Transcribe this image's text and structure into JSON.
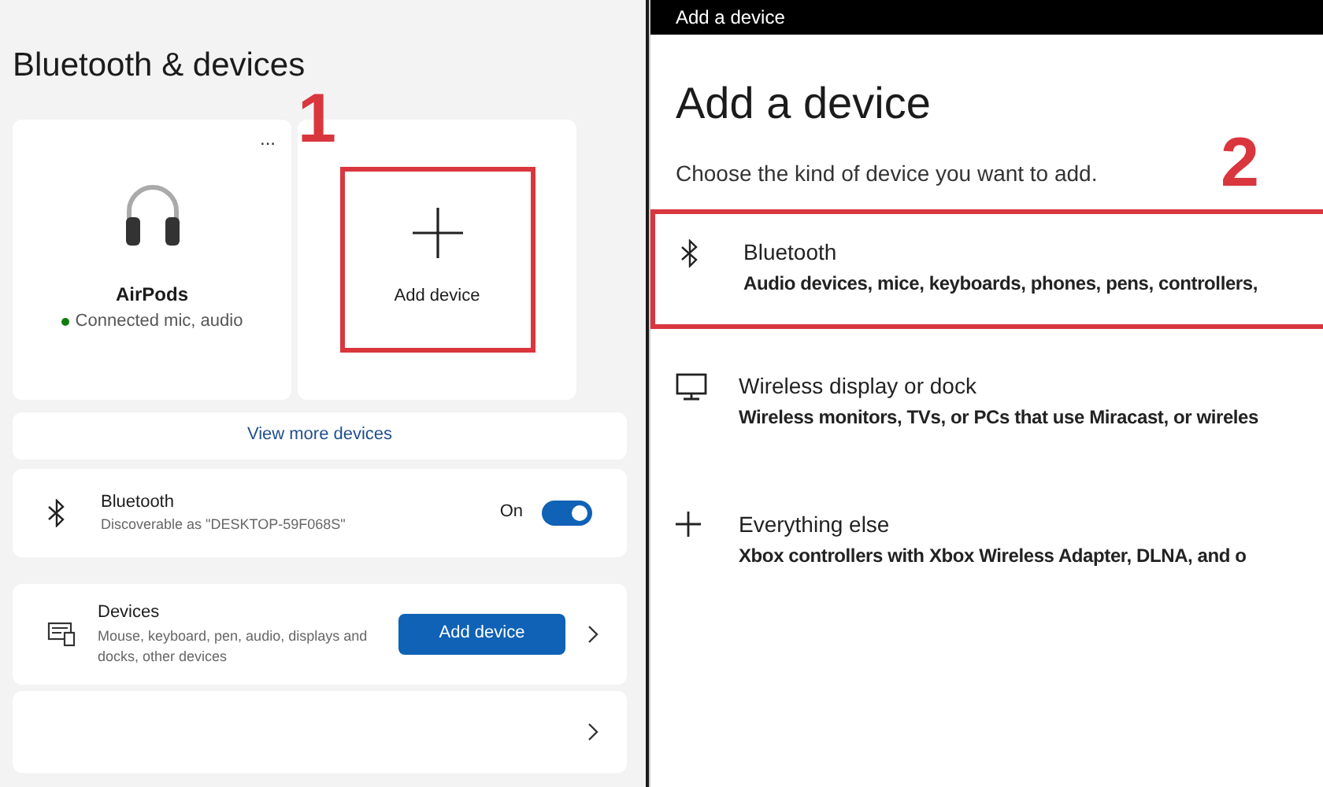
{
  "settings": {
    "title": "Bluetooth & devices",
    "tiles": [
      {
        "kind": "device",
        "name": "AirPods",
        "status": "Connected mic, audio",
        "color": "#107c10",
        "menu": "..."
      },
      {
        "kind": "add",
        "name": "Add device",
        "highlighted": true,
        "step": "1"
      }
    ],
    "view_more": "View more devices",
    "bluetooth": {
      "title": "Bluetooth",
      "subtitle": "Discoverable as \"DESKTOP-59F068S\"",
      "state_label": "On",
      "on": true
    },
    "devices": {
      "title": "Devices",
      "subtitle": "Mouse, keyboard, pen, audio, displays and docks, other devices",
      "button": "Add device"
    },
    "more_row": {
      "chevron": true
    }
  },
  "dialog": {
    "window_title": "Add a device",
    "heading": "Add a device",
    "subtitle": "Choose the kind of device you want to add.",
    "step": "2",
    "options": [
      {
        "kind": "bluetooth",
        "title": "Bluetooth",
        "description": "Audio devices, mice, keyboards, phones, pens, controllers,",
        "highlighted": true
      },
      {
        "kind": "display",
        "title": "Wireless display or dock",
        "description": "Wireless monitors, TVs, or PCs that use Miracast, or wireles",
        "highlighted": false
      },
      {
        "kind": "other",
        "title": "Everything else",
        "description": "Xbox controllers with Xbox Wireless Adapter, DLNA, and o",
        "highlighted": false
      }
    ]
  }
}
